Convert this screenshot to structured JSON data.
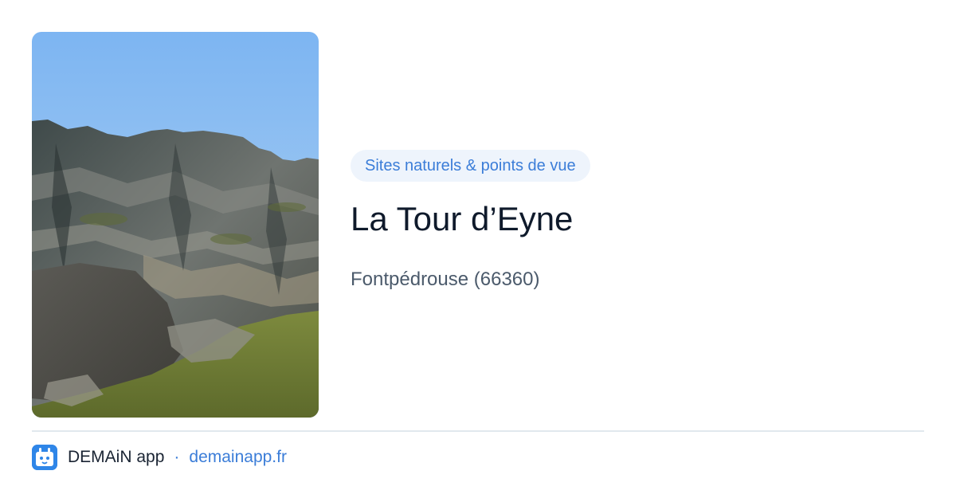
{
  "place": {
    "category": "Sites naturels & points de vue",
    "title": "La Tour d’Eyne",
    "location": "Fontpédrouse (66360)",
    "photo": "mountain-ridge-photo"
  },
  "footer": {
    "app_name": "DEMAiN app",
    "separator": "·",
    "link": "demainapp.fr",
    "logo_icon": "calendar-tiger-icon"
  },
  "colors": {
    "accent": "#3b7dd8",
    "chip_bg": "#eef4fc",
    "title": "#0f1a2b",
    "subtitle": "#4b5a6b",
    "divider": "#e1e8ee"
  }
}
